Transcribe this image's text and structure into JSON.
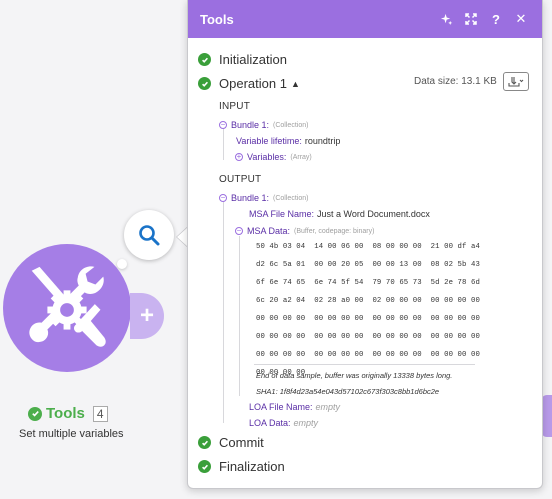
{
  "module": {
    "name": "Tools",
    "badge": "4",
    "description": "Set multiple variables",
    "accent": "#a57ee6",
    "status_color": "#4cae4c"
  },
  "panel": {
    "title": "Tools",
    "header_color": "#9b6fe0",
    "header_icons": [
      "sparkle-icon",
      "expand-icon",
      "help-icon",
      "close-icon"
    ],
    "help_label": "?",
    "close_label": "✕"
  },
  "sections": {
    "initialization": "Initialization",
    "operation": "Operation 1",
    "operation_caret": "▲",
    "data_size": "Data size: 13.1 KB",
    "commit": "Commit",
    "finalization": "Finalization"
  },
  "input": {
    "heading": "INPUT",
    "bundle": {
      "key": "Bundle 1:",
      "meta": "(Collection)"
    },
    "variable_lifetime": {
      "key": "Variable lifetime:",
      "value": "roundtrip"
    },
    "variables": {
      "key": "Variables:",
      "meta": "(Array)"
    }
  },
  "output": {
    "heading": "OUTPUT",
    "bundle": {
      "key": "Bundle 1:",
      "meta": "(Collection)"
    },
    "msa_file_name": {
      "key": "MSA File Name:",
      "value": "Just a Word Document.docx"
    },
    "msa_data": {
      "key": "MSA Data:",
      "meta": "(Buffer, codepage: binary)"
    },
    "hex_rows": [
      "50 4b 03 04  14 00 06 00  08 00 00 00  21 00 df a4",
      "d2 6c 5a 01  00 00 20 05  00 00 13 00  08 02 5b 43",
      "6f 6e 74 65  6e 74 5f 54  79 70 65 73  5d 2e 78 6d",
      "6c 20 a2 04  02 28 a0 00  02 00 00 00  00 00 00 00",
      "00 00 00 00  00 00 00 00  00 00 00 00  00 00 00 00",
      "00 00 00 00  00 00 00 00  00 00 00 00  00 00 00 00",
      "00 00 00 00  00 00 00 00  00 00 00 00  00 00 00 00",
      "00 00 00 00"
    ],
    "end_note": "End of data sample, buffer was originally 13338 bytes long.",
    "sha1": "SHA1: 1f8f4d23a54e043d57102c673f303c8bb1d6bc2e",
    "loa_file_name": {
      "key": "LOA File Name:",
      "value": "empty"
    },
    "loa_data": {
      "key": "LOA Data:",
      "value": "empty"
    }
  }
}
